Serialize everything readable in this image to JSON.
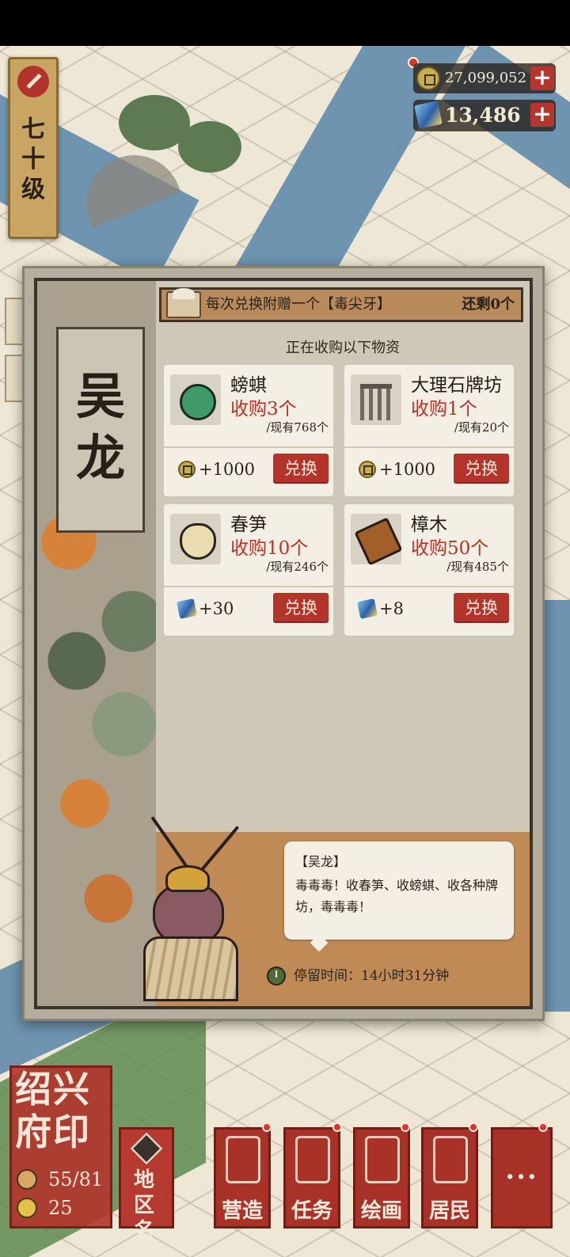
{
  "player": {
    "level": "七十级"
  },
  "currency": {
    "coins": "27,099,052",
    "gems": "13,486",
    "plus": "+"
  },
  "npc": {
    "name": "吴龙",
    "bonus_text": "每次兑换附赠一个【毒尖牙】",
    "remaining": "还剩0个",
    "subtitle": "正在收购以下物资",
    "speaker": "【吴龙】",
    "dialogue": "毒毒毒！收春笋、收螃蜞、收各种牌坊，毒毒毒！",
    "stay_time": "停留时间：14小时31分钟"
  },
  "items": [
    {
      "name": "螃蜞",
      "buy": "收购3个",
      "own": "/现有768个",
      "reward_type": "coin-icon",
      "reward": "+1000",
      "button": "兑换",
      "icon": "crab-icon"
    },
    {
      "name": "大理石牌坊",
      "buy": "收购1个",
      "own": "/现有20个",
      "reward_type": "coin-icon",
      "reward": "+1000",
      "button": "兑换",
      "icon": "archway-icon"
    },
    {
      "name": "春笋",
      "buy": "收购10个",
      "own": "/现有246个",
      "reward_type": "gem-icon",
      "reward": "+30",
      "button": "兑换",
      "icon": "bamboo-shoot-icon"
    },
    {
      "name": "樟木",
      "buy": "收购50个",
      "own": "/现有485个",
      "reward_type": "gem-icon",
      "reward": "+8",
      "button": "兑换",
      "icon": "camphor-wood-icon"
    }
  ],
  "bottom": {
    "seal_title": "绍兴府印",
    "population": "55/81",
    "happiness": "25",
    "region": "地区名",
    "menu": [
      "营造",
      "任务",
      "绘画",
      "居民"
    ],
    "more": "···"
  },
  "colors": {
    "accent_red": "#b3342b",
    "water": "#6e94b0",
    "paper": "#f3efe5"
  }
}
